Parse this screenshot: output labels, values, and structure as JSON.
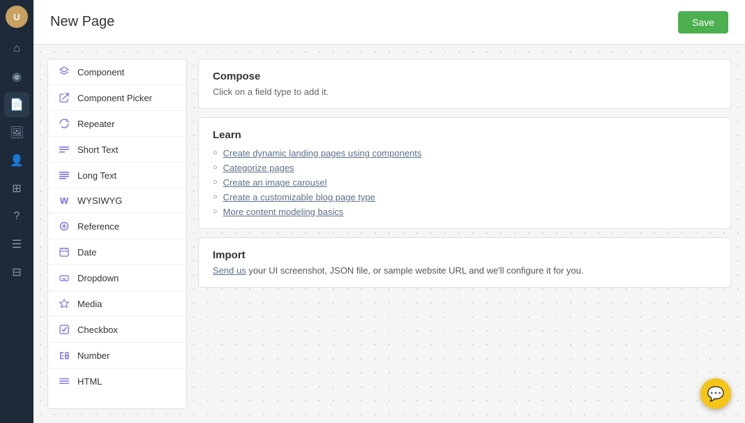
{
  "page": {
    "title": "New Page",
    "save_button": "Save"
  },
  "sidebar": {
    "avatar_initials": "U",
    "items": [
      {
        "label": "home",
        "icon": "⌂",
        "active": false
      },
      {
        "label": "analytics",
        "icon": "◎",
        "active": false
      },
      {
        "label": "document",
        "icon": "📄",
        "active": true
      },
      {
        "label": "image",
        "icon": "🖼",
        "active": false
      },
      {
        "label": "users",
        "icon": "👤",
        "active": false
      },
      {
        "label": "layers",
        "icon": "⊞",
        "active": false
      },
      {
        "label": "help",
        "icon": "?",
        "active": false
      },
      {
        "label": "notes",
        "icon": "☰",
        "active": false
      },
      {
        "label": "stack",
        "icon": "⊟",
        "active": false
      }
    ]
  },
  "component_panel": {
    "items": [
      {
        "label": "Component",
        "icon": "layers"
      },
      {
        "label": "Component Picker",
        "icon": "picker"
      },
      {
        "label": "Repeater",
        "icon": "repeat"
      },
      {
        "label": "Short Text",
        "icon": "short-text"
      },
      {
        "label": "Long Text",
        "icon": "long-text"
      },
      {
        "label": "WYSIWYG",
        "icon": "wysiwyg"
      },
      {
        "label": "Reference",
        "icon": "reference"
      },
      {
        "label": "Date",
        "icon": "date"
      },
      {
        "label": "Dropdown",
        "icon": "dropdown"
      },
      {
        "label": "Media",
        "icon": "media"
      },
      {
        "label": "Checkbox",
        "icon": "checkbox"
      },
      {
        "label": "Number",
        "icon": "number"
      },
      {
        "label": "HTML",
        "icon": "html"
      }
    ]
  },
  "compose": {
    "title": "Compose",
    "subtitle": "Click on a field type to add it."
  },
  "learn": {
    "title": "Learn",
    "links": [
      "Create dynamic landing pages using components",
      "Categorize pages",
      "Create an image carousel",
      "Create a customizable blog page type",
      "More content modeling basics"
    ]
  },
  "import_section": {
    "title": "Import",
    "pre_link": "Send us",
    "link_text": "Send us",
    "text": " your UI screenshot, JSON file, or sample website URL and we'll configure it for you."
  },
  "icons": {
    "layers": "◫",
    "picker": "⊕",
    "repeat": "↻",
    "short-text": "≡",
    "long-text": "≡",
    "wysiwyg": "¶",
    "reference": "↻",
    "date": "📅",
    "dropdown": "▾",
    "media": "▲",
    "checkbox": "☑",
    "number": "#",
    "html": "≡"
  }
}
